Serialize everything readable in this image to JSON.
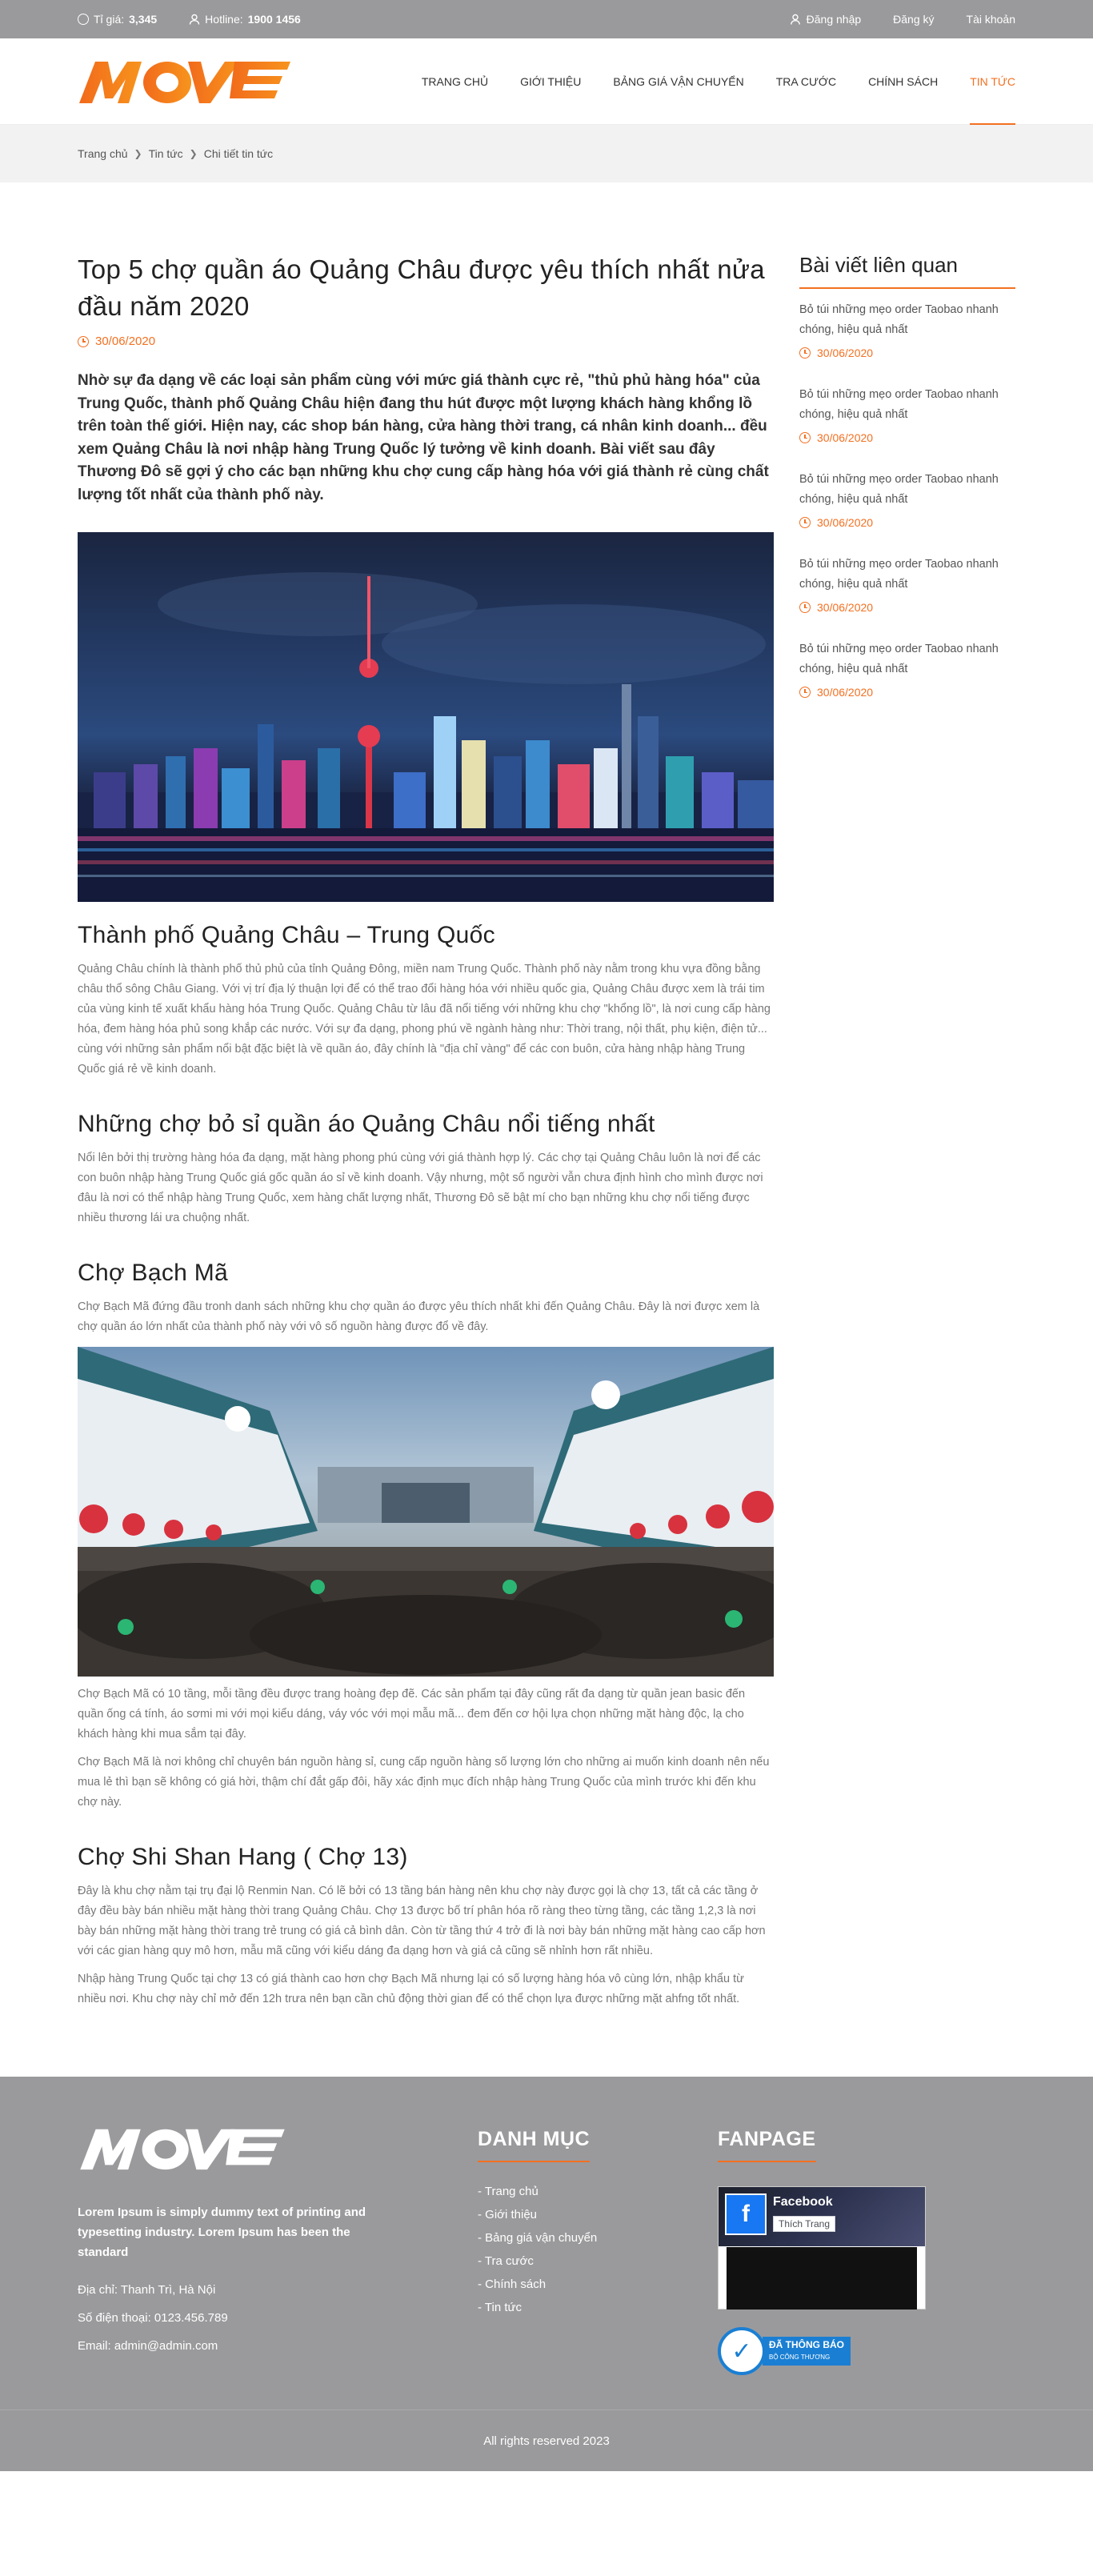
{
  "topbar": {
    "rate_label": "Tỉ giá:",
    "rate_value": "3,345",
    "hotline_label": "Hotline:",
    "hotline_value": "1900 1456",
    "login": "Đăng nhập",
    "register": "Đăng ký",
    "account": "Tài khoản"
  },
  "logo": {
    "text": "MOVE"
  },
  "nav": {
    "items": [
      "TRANG CHỦ",
      "GIỚI THIỆU",
      "BẢNG GIÁ VẬN CHUYỂN",
      "TRA CƯỚC",
      "CHÍNH SÁCH",
      "TIN TỨC"
    ],
    "active_index": 5
  },
  "breadcrumb": [
    "Trang chủ",
    "Tin tức",
    "Chi tiết tin tức"
  ],
  "article": {
    "title": "Top 5 chợ quần áo Quảng Châu được yêu thích nhất nửa đầu năm 2020",
    "date": "30/06/2020",
    "lead": "Nhờ sự đa dạng về các loại sản phẩm cùng với mức giá thành cực rẻ, \"thủ phủ hàng hóa\" của Trung Quốc, thành phố Quảng Châu hiện đang thu hút được một lượng khách hàng khổng lồ trên toàn thế giới. Hiện nay, các shop bán hàng, cửa hàng thời trang, cá nhân kinh doanh... đều xem Quảng Châu là nơi nhập hàng Trung Quốc lý tưởng về kinh doanh. Bài viết sau đây Thương Đô sẽ gợi ý cho các bạn những khu chợ cung cấp hàng hóa với giá thành rẻ cùng chất lượng tốt nhất của thành phố này.",
    "section1_title": "Thành phố Quảng Châu – Trung Quốc",
    "section1_p": "Quảng Châu chính là thành phố thủ phủ của tỉnh Quảng Đông, miền nam Trung Quốc. Thành phố này nằm trong khu vựa đồng bằng châu thổ sông Châu Giang. Với vị trí địa lý thuận lợi để có thể trao đổi hàng hóa với nhiều quốc gia, Quảng Châu được xem là trái tim của vùng kinh tế xuất khẩu hàng hóa Trung Quốc. Quảng Châu từ lâu đã nổi tiếng với những khu chợ \"khổng lồ\", là nơi cung cấp hàng hóa, đem hàng hóa phủ song khắp các nước. Với sự đa dạng, phong phú về ngành hàng như: Thời trang, nội thất, phụ kiện, điện tử... cùng với những sản phẩm nổi bật đặc biệt là về quần áo, đây chính là \"địa chỉ vàng\" để các con buôn, cửa hàng nhập hàng Trung Quốc giá rẻ về kinh doanh.",
    "section2_title": "Những chợ bỏ sỉ quần áo Quảng Châu nổi tiếng nhất",
    "section2_p": "Nổi lên bởi thị trường hàng hóa đa dạng, mặt hàng phong phú cùng với giá thành hợp lý. Các chợ tại Quảng Châu luôn là nơi để các con buôn nhập hàng Trung Quốc giá gốc quần áo sỉ về kinh doanh. Vậy nhưng, một số người vẫn chưa định hình cho mình được nơi đâu là nơi có thể nhập hàng Trung Quốc, xem hàng chất lượng nhất, Thương Đô sẽ bật mí cho bạn những khu chợ nổi tiếng được nhiều thương lái ưa chuộng nhất.",
    "section3_title": "Chợ Bạch Mã",
    "section3_p1": "Chợ Bạch Mã đứng đầu tronh danh sách những khu chợ quần áo được yêu thích nhất khi đến Quảng Châu. Đây là nơi được xem là chợ quần áo lớn nhất của thành phố này với vô số nguồn hàng được đổ về đây.",
    "section3_p2": "Chợ Bạch Mã có 10 tầng, mỗi tầng đều được trang hoàng đẹp đẽ. Các sản phẩm tại đây cũng rất đa dạng từ quần jean basic đến quần ống cá tính, áo sơmi mi với mọi kiểu dáng, váy vóc với mọi mẫu mã... đem đến cơ hội lựa chọn những mặt hàng độc, lạ cho khách hàng khi mua sắm tại đây.",
    "section3_p3": "Chợ Bạch Mã là nơi không chỉ chuyên bán nguồn hàng sỉ, cung cấp nguồn hàng số lượng lớn cho những ai muốn kinh doanh nên nếu mua lẻ thì bạn sẽ không có giá hời, thậm chí đắt gấp đôi, hãy xác định mục đích nhập hàng Trung Quốc của mình trước khi đến khu chợ này.",
    "section4_title": "Chợ Shi Shan Hang ( Chợ 13)",
    "section4_p1": "Đây là khu chợ nằm tại trụ đại lộ Renmin Nan. Có lẽ bởi có 13 tầng bán hàng nên khu chợ này được gọi là chợ 13, tất cả các tầng ở đây đều bày bán nhiều mặt hàng thời trang Quảng Châu. Chợ 13 được bố trí phân hóa rõ ràng theo từng tầng, các tầng 1,2,3 là nơi bày bán những mặt hàng thời trang trẻ trung có giá cả bình dân. Còn từ tầng thứ 4 trở đi là nơi bày bán những mặt hàng cao cấp hơn với các gian hàng quy mô hơn, mẫu mã cũng với kiểu dáng đa dạng hơn và giá cả cũng sẽ nhỉnh hơn rất nhiều.",
    "section4_p2": "Nhập hàng Trung Quốc tại chợ 13 có giá thành cao hơn chợ Bạch Mã nhưng lại có số lượng hàng hóa vô cùng lớn, nhập khẩu từ nhiều nơi. Khu chợ này chỉ mở đến 12h trưa nên bạn cần chủ động thời gian để có thể chọn lựa được những mặt ahfng tốt nhất."
  },
  "sidebar": {
    "title": "Bài viết liên quan",
    "items": [
      {
        "title": "Bỏ túi những mẹo order Taobao nhanh chóng, hiệu quả nhất",
        "date": "30/06/2020"
      },
      {
        "title": "Bỏ túi những mẹo order Taobao nhanh chóng, hiệu quả nhất",
        "date": "30/06/2020"
      },
      {
        "title": "Bỏ túi những mẹo order Taobao nhanh chóng, hiệu quả nhất",
        "date": "30/06/2020"
      },
      {
        "title": "Bỏ túi những mẹo order Taobao nhanh chóng, hiệu quả nhất",
        "date": "30/06/2020"
      },
      {
        "title": "Bỏ túi những mẹo order Taobao nhanh chóng, hiệu quả nhất",
        "date": "30/06/2020"
      }
    ]
  },
  "footer": {
    "logo_text": "MOVE",
    "desc": "Lorem Ipsum is simply dummy text of printing and typesetting industry. Lorem Ipsum has been the standard",
    "address": "Địa chỉ: Thanh Trì, Hà Nội",
    "phone": "Số điện thoại: 0123.456.789",
    "email": "Email: admin@admin.com",
    "menu_heading": "DANH MỤC",
    "menu_items": [
      "- Trang chủ",
      "- Giới thiệu",
      "- Bảng giá vận chuyển",
      "- Tra cước",
      "- Chính sách",
      "- Tin tức"
    ],
    "fanpage_heading": "FANPAGE",
    "fb_name": "Facebook",
    "fb_like": "Thích Trang",
    "badge_title": "ĐÃ THÔNG BÁO",
    "badge_sub": "BỘ CÔNG THƯƠNG",
    "copyright": "All rights reserved 2023"
  },
  "colors": {
    "accent": "#f37021",
    "topbar_bg": "#9a9a9c",
    "footer_bg": "#9a9a9c"
  }
}
